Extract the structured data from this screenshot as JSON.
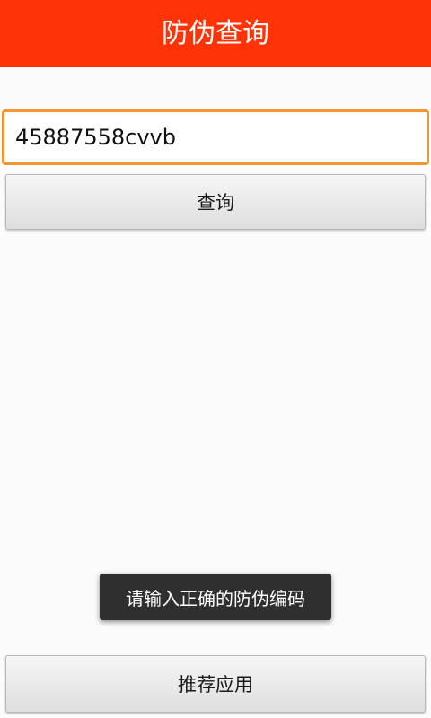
{
  "header": {
    "title": "防伪查询"
  },
  "search": {
    "value": "45887558cvvb",
    "query_button_label": "查询"
  },
  "toast": {
    "message": "请输入正确的防伪编码"
  },
  "footer": {
    "recommend_button_label": "推荐应用"
  },
  "colors": {
    "header_background": "#ff3308",
    "input_focus_border": "#f4962e",
    "toast_background": "#2f2f2f"
  }
}
